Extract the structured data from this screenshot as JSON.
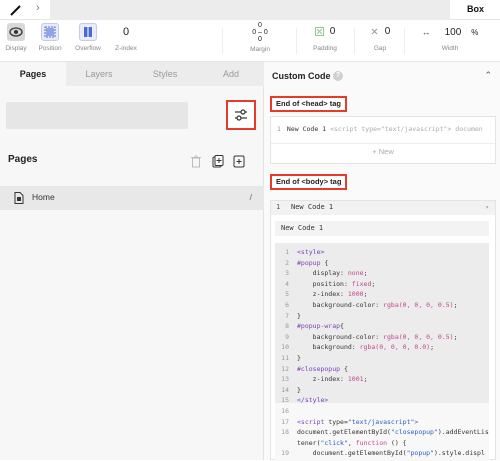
{
  "topbar": {
    "element_label": "Box"
  },
  "toolbar": {
    "display_label": "Display",
    "position_label": "Position",
    "overflow_label": "Overflow",
    "zindex_value": "0",
    "zindex_label": "Z-index",
    "margin_top": "0",
    "margin_left": "0",
    "margin_right": "0",
    "margin_bottom": "0",
    "margin_label": "Margin",
    "padding_value": "0",
    "padding_label": "Padding",
    "gap_value": "0",
    "gap_label": "Gap",
    "width_value": "100",
    "width_unit": "%",
    "width_label": "Width"
  },
  "left": {
    "tabs": [
      "Pages",
      "Layers",
      "Styles",
      "Add"
    ],
    "active_tab": "Pages",
    "pages_heading": "Pages",
    "pages": [
      {
        "name": "Home",
        "path": "/"
      }
    ]
  },
  "right": {
    "title": "Custom Code",
    "head_tag_label": "End of <head> tag",
    "head_code": {
      "line_no": "1",
      "name": "New Code 1",
      "snippet": "<script type=\"text/javascript\"> documen"
    },
    "new_button": "+ New",
    "body_tag_label": "End of <body> tag",
    "body_code": {
      "line_no": "1",
      "name": "New Code 1",
      "name_input": "New Code 1",
      "lines": [
        {
          "n": "1",
          "t": [
            [
              "tag",
              "<style>"
            ]
          ]
        },
        {
          "n": "2",
          "t": [
            [
              "sel",
              "#popup"
            ],
            [
              "plain",
              " {"
            ]
          ]
        },
        {
          "n": "3",
          "t": [
            [
              "prop",
              "    display: "
            ],
            [
              "val",
              "none"
            ],
            [
              "plain",
              ";"
            ]
          ]
        },
        {
          "n": "4",
          "t": [
            [
              "prop",
              "    position: "
            ],
            [
              "val",
              "fixed"
            ],
            [
              "plain",
              ";"
            ]
          ]
        },
        {
          "n": "5",
          "t": [
            [
              "prop",
              "    z-index: "
            ],
            [
              "val",
              "1000"
            ],
            [
              "plain",
              ";"
            ]
          ]
        },
        {
          "n": "6",
          "t": [
            [
              "prop",
              "    background-color: "
            ],
            [
              "val",
              "rgba(0, 0, 0, 0.5)"
            ],
            [
              "plain",
              ";"
            ]
          ]
        },
        {
          "n": "7",
          "t": [
            [
              "plain",
              "}"
            ]
          ]
        },
        {
          "n": "8",
          "t": [
            [
              "sel",
              "#popup-wrap"
            ],
            [
              "plain",
              "{"
            ]
          ]
        },
        {
          "n": "9",
          "t": [
            [
              "prop",
              "    background-color: "
            ],
            [
              "val",
              "rgba(0, 0, 0, 0.5)"
            ],
            [
              "plain",
              ";"
            ]
          ]
        },
        {
          "n": "10",
          "t": [
            [
              "prop",
              "    background: "
            ],
            [
              "val",
              "rgba(0, 0, 0, 0.0)"
            ],
            [
              "plain",
              ";"
            ]
          ]
        },
        {
          "n": "11",
          "t": [
            [
              "plain",
              "}"
            ]
          ]
        },
        {
          "n": "12",
          "t": [
            [
              "sel",
              "#closepopup"
            ],
            [
              "plain",
              " {"
            ]
          ]
        },
        {
          "n": "13",
          "t": [
            [
              "prop",
              "    z-index: "
            ],
            [
              "val",
              "1001"
            ],
            [
              "plain",
              ";"
            ]
          ]
        },
        {
          "n": "14",
          "t": [
            [
              "plain",
              "}"
            ]
          ]
        },
        {
          "n": "15",
          "t": [
            [
              "tag",
              "</style>"
            ]
          ]
        },
        {
          "n": "16",
          "t": [
            [
              "plain",
              ""
            ]
          ]
        },
        {
          "n": "17",
          "t": [
            [
              "tag",
              "<script "
            ],
            [
              "prop",
              "type="
            ],
            [
              "str",
              "\"text/javascript\""
            ],
            [
              "tag",
              ">"
            ]
          ]
        },
        {
          "n": "18",
          "t": [
            [
              "plain",
              "document.getElementById("
            ],
            [
              "str",
              "\"closepopup\""
            ],
            [
              "plain",
              ").addEventLis"
            ]
          ]
        },
        {
          "n": "",
          "t": [
            [
              "plain",
              "tener("
            ],
            [
              "str",
              "\"click\""
            ],
            [
              "plain",
              ", "
            ],
            [
              "val",
              "function"
            ],
            [
              "plain",
              " () {"
            ]
          ]
        },
        {
          "n": "19",
          "t": [
            [
              "plain",
              "    document.getElementById("
            ],
            [
              "str",
              "\"popup\""
            ],
            [
              "plain",
              ").style.displ"
            ]
          ]
        }
      ]
    }
  },
  "colors": {
    "highlight_border": "#e53b2c",
    "accent": "#4a6cd4"
  },
  "icons": [
    "pen-icon",
    "chevron-right-icon",
    "display-icon",
    "position-icon",
    "overflow-icon",
    "padding-icon",
    "gap-icon",
    "width-icon",
    "filter-settings-icon",
    "trash-icon",
    "duplicate-page-icon",
    "add-page-icon",
    "page-icon",
    "help-icon",
    "caret-up-icon",
    "chevron-down-icon"
  ]
}
